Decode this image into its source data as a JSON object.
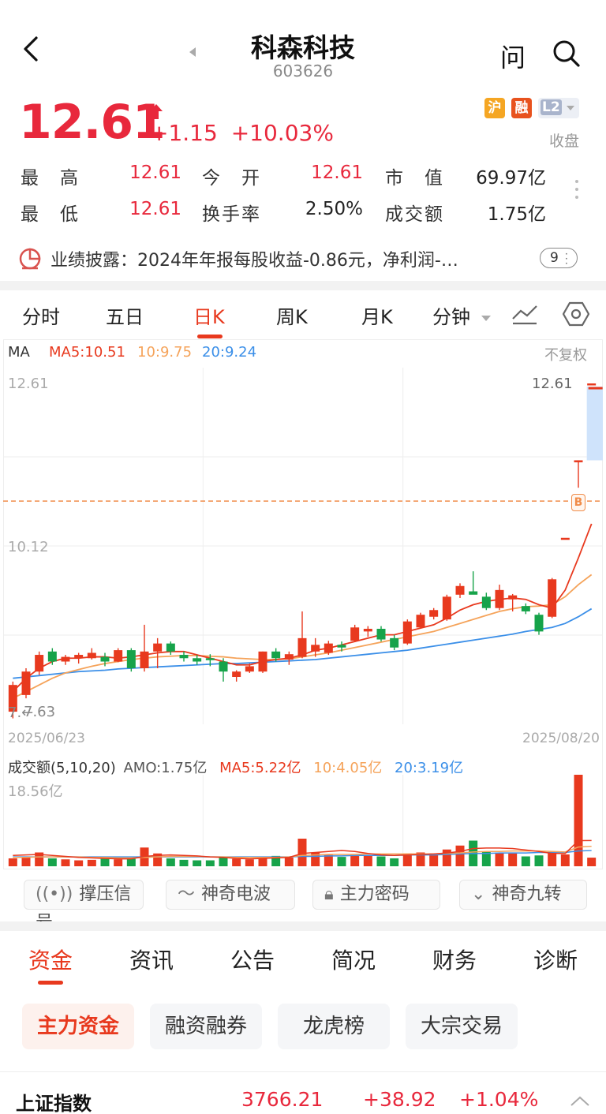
{
  "header": {
    "title": "科森科技",
    "code": "603626",
    "ask_label": "问"
  },
  "quote": {
    "price": "12.61",
    "change": "+1.15",
    "change_pct": "+10.03%",
    "badges": [
      "沪",
      "融",
      "L2"
    ],
    "status": "收盘",
    "stats": [
      {
        "label": "最　高",
        "value": "12.61",
        "color": "red"
      },
      {
        "label": "今　开",
        "value": "12.61",
        "color": "red"
      },
      {
        "label": "市　值",
        "value": "69.97亿",
        "color": "dark"
      },
      {
        "label": "最　低",
        "value": "12.61",
        "color": "red"
      },
      {
        "label": "换手率",
        "value": "2.50%",
        "color": "dark"
      },
      {
        "label": "成交额",
        "value": "1.75亿",
        "color": "dark"
      }
    ]
  },
  "notice": {
    "text": "业绩披露：2024年年报每股收益-0.86元，净利润-…",
    "count": "9"
  },
  "chart_tabs": [
    "分时",
    "五日",
    "日K",
    "周K",
    "月K",
    "分钟"
  ],
  "active_chart_tab": "日K",
  "ma": {
    "label": "MA",
    "ma5": "MA5:10.51",
    "ma10": "10:9.75",
    "ma20": "20:9.24",
    "adjust": "不复权"
  },
  "price_axis": {
    "high": "12.61",
    "mid": "10.12",
    "low": "7.63",
    "last_label": "12.61",
    "buy_marker": "B"
  },
  "date_axis": {
    "start": "2025/06/23",
    "end": "2025/08/20"
  },
  "volume_header": {
    "title": "成交额(5,10,20)",
    "amo": "AMO:1.75亿",
    "ma5": "MA5:5.22亿",
    "ma10": "10:4.05亿",
    "ma20": "20:3.19亿",
    "max": "18.56亿"
  },
  "colors": {
    "up": "#e8391e",
    "down": "#16a34a",
    "ma5": "#e8391e",
    "ma10": "#f5a35a",
    "ma20": "#3b8fe8",
    "accent": "#e8391e"
  },
  "chart_data": {
    "type": "candlestick",
    "x_start": "2025/06/23",
    "x_end": "2025/08/20",
    "ylim": [
      7.63,
      12.61
    ],
    "candles": [
      {
        "o": 7.7,
        "h": 8.15,
        "l": 7.6,
        "c": 8.1
      },
      {
        "o": 7.95,
        "h": 8.35,
        "l": 7.9,
        "c": 8.3
      },
      {
        "o": 8.3,
        "h": 8.6,
        "l": 8.25,
        "c": 8.55
      },
      {
        "o": 8.6,
        "h": 8.65,
        "l": 8.4,
        "c": 8.45
      },
      {
        "o": 8.45,
        "h": 8.55,
        "l": 8.4,
        "c": 8.52
      },
      {
        "o": 8.5,
        "h": 8.58,
        "l": 8.42,
        "c": 8.55
      },
      {
        "o": 8.5,
        "h": 8.65,
        "l": 8.48,
        "c": 8.58
      },
      {
        "o": 8.52,
        "h": 8.58,
        "l": 8.38,
        "c": 8.45
      },
      {
        "o": 8.45,
        "h": 8.65,
        "l": 8.44,
        "c": 8.62
      },
      {
        "o": 8.62,
        "h": 8.65,
        "l": 8.3,
        "c": 8.35
      },
      {
        "o": 8.35,
        "h": 9.0,
        "l": 8.3,
        "c": 8.6
      },
      {
        "o": 8.6,
        "h": 8.8,
        "l": 8.35,
        "c": 8.72
      },
      {
        "o": 8.72,
        "h": 8.75,
        "l": 8.55,
        "c": 8.6
      },
      {
        "o": 8.55,
        "h": 8.6,
        "l": 8.45,
        "c": 8.5
      },
      {
        "o": 8.5,
        "h": 8.55,
        "l": 8.4,
        "c": 8.45
      },
      {
        "o": 8.5,
        "h": 8.56,
        "l": 8.38,
        "c": 8.48
      },
      {
        "o": 8.45,
        "h": 8.5,
        "l": 8.15,
        "c": 8.3
      },
      {
        "o": 8.22,
        "h": 8.32,
        "l": 8.15,
        "c": 8.3
      },
      {
        "o": 8.3,
        "h": 8.42,
        "l": 8.28,
        "c": 8.38
      },
      {
        "o": 8.3,
        "h": 8.6,
        "l": 8.28,
        "c": 8.6
      },
      {
        "o": 8.6,
        "h": 8.65,
        "l": 8.45,
        "c": 8.5
      },
      {
        "o": 8.48,
        "h": 8.6,
        "l": 8.4,
        "c": 8.56
      },
      {
        "o": 8.52,
        "h": 9.2,
        "l": 8.5,
        "c": 8.8
      },
      {
        "o": 8.6,
        "h": 8.8,
        "l": 8.52,
        "c": 8.7
      },
      {
        "o": 8.58,
        "h": 8.76,
        "l": 8.55,
        "c": 8.72
      },
      {
        "o": 8.7,
        "h": 8.75,
        "l": 8.6,
        "c": 8.66
      },
      {
        "o": 8.76,
        "h": 9.0,
        "l": 8.74,
        "c": 8.96
      },
      {
        "o": 8.9,
        "h": 8.98,
        "l": 8.82,
        "c": 8.94
      },
      {
        "o": 8.94,
        "h": 8.98,
        "l": 8.75,
        "c": 8.78
      },
      {
        "o": 8.8,
        "h": 8.85,
        "l": 8.62,
        "c": 8.66
      },
      {
        "o": 8.72,
        "h": 9.08,
        "l": 8.7,
        "c": 9.05
      },
      {
        "o": 8.96,
        "h": 9.18,
        "l": 8.94,
        "c": 9.15
      },
      {
        "o": 9.12,
        "h": 9.25,
        "l": 9.08,
        "c": 9.22
      },
      {
        "o": 9.08,
        "h": 9.45,
        "l": 9.06,
        "c": 9.42
      },
      {
        "o": 9.45,
        "h": 9.62,
        "l": 9.4,
        "c": 9.58
      },
      {
        "o": 9.5,
        "h": 9.8,
        "l": 9.48,
        "c": 9.45
      },
      {
        "o": 9.42,
        "h": 9.48,
        "l": 9.22,
        "c": 9.25
      },
      {
        "o": 9.25,
        "h": 9.6,
        "l": 9.22,
        "c": 9.52
      },
      {
        "o": 9.38,
        "h": 9.46,
        "l": 9.2,
        "c": 9.44
      },
      {
        "o": 9.28,
        "h": 9.32,
        "l": 9.16,
        "c": 9.2
      },
      {
        "o": 9.15,
        "h": 9.18,
        "l": 8.85,
        "c": 8.9
      },
      {
        "o": 9.12,
        "h": 9.7,
        "l": 9.1,
        "c": 9.68
      },
      {
        "o": 10.3,
        "h": 10.3,
        "l": 10.3,
        "c": 10.3
      },
      {
        "o": 11.46,
        "h": 11.46,
        "l": 11.05,
        "c": 11.46
      },
      {
        "o": 12.61,
        "h": 12.61,
        "l": 12.61,
        "c": 12.61
      }
    ],
    "ma5": [
      8.0,
      8.2,
      8.35,
      8.45,
      8.5,
      8.5,
      8.52,
      8.52,
      8.5,
      8.52,
      8.55,
      8.58,
      8.6,
      8.6,
      8.55,
      8.5,
      8.45,
      8.4,
      8.4,
      8.45,
      8.48,
      8.5,
      8.55,
      8.62,
      8.65,
      8.7,
      8.75,
      8.8,
      8.85,
      8.85,
      8.9,
      8.95,
      9.0,
      9.1,
      9.22,
      9.3,
      9.35,
      9.38,
      9.4,
      9.38,
      9.3,
      9.25,
      9.52,
      10.0,
      10.51
    ],
    "ma10": [
      7.9,
      8.0,
      8.1,
      8.2,
      8.28,
      8.33,
      8.38,
      8.42,
      8.45,
      8.48,
      8.5,
      8.52,
      8.53,
      8.54,
      8.54,
      8.53,
      8.52,
      8.5,
      8.49,
      8.48,
      8.48,
      8.49,
      8.52,
      8.55,
      8.58,
      8.62,
      8.66,
      8.7,
      8.74,
      8.78,
      8.82,
      8.86,
      8.9,
      8.96,
      9.02,
      9.08,
      9.14,
      9.2,
      9.24,
      9.27,
      9.28,
      9.3,
      9.42,
      9.6,
      9.75
    ],
    "ma20": [
      8.2,
      8.22,
      8.24,
      8.26,
      8.28,
      8.3,
      8.31,
      8.32,
      8.34,
      8.35,
      8.36,
      8.37,
      8.38,
      8.39,
      8.4,
      8.41,
      8.42,
      8.42,
      8.43,
      8.44,
      8.45,
      8.46,
      8.47,
      8.48,
      8.5,
      8.52,
      8.54,
      8.56,
      8.58,
      8.6,
      8.62,
      8.65,
      8.68,
      8.71,
      8.74,
      8.77,
      8.8,
      8.83,
      8.86,
      8.9,
      8.93,
      8.96,
      9.02,
      9.12,
      9.24
    ],
    "volume": {
      "ymax": 18.56,
      "amo": [
        1.6,
        2.0,
        2.8,
        1.6,
        1.4,
        1.2,
        1.3,
        1.5,
        1.4,
        1.5,
        3.8,
        2.6,
        1.6,
        1.3,
        1.2,
        1.2,
        2.0,
        1.5,
        1.4,
        2.0,
        2.1,
        1.8,
        5.6,
        2.8,
        2.4,
        1.9,
        2.4,
        2.1,
        2.0,
        1.6,
        2.6,
        2.8,
        2.6,
        3.4,
        4.2,
        5.2,
        2.9,
        2.8,
        2.6,
        2.0,
        2.2,
        2.8,
        2.4,
        18.56,
        1.75
      ],
      "ma5": [
        2.2,
        2.3,
        2.4,
        2.2,
        2.0,
        1.8,
        1.7,
        1.6,
        1.5,
        1.5,
        2.0,
        2.2,
        2.3,
        2.2,
        2.1,
        1.9,
        1.8,
        1.6,
        1.5,
        1.6,
        1.7,
        1.8,
        2.6,
        2.8,
        3.0,
        3.2,
        3.0,
        2.6,
        2.3,
        2.2,
        2.3,
        2.4,
        2.5,
        2.7,
        3.0,
        3.6,
        3.7,
        3.7,
        3.6,
        3.3,
        3.0,
        2.6,
        2.6,
        5.2,
        5.22
      ],
      "ma10": [
        1.8,
        1.8,
        1.9,
        1.9,
        1.9,
        1.9,
        1.8,
        1.8,
        1.7,
        1.7,
        1.8,
        1.9,
        2.0,
        2.0,
        2.0,
        1.9,
        1.9,
        1.8,
        1.8,
        1.8,
        1.8,
        1.9,
        2.2,
        2.3,
        2.4,
        2.4,
        2.4,
        2.5,
        2.5,
        2.5,
        2.5,
        2.5,
        2.5,
        2.6,
        2.7,
        2.9,
        3.0,
        3.0,
        3.1,
        3.1,
        3.1,
        3.0,
        2.9,
        3.9,
        4.05
      ],
      "ma20": [
        1.9,
        1.9,
        1.9,
        1.9,
        1.9,
        1.9,
        1.9,
        1.9,
        1.9,
        1.9,
        1.9,
        1.9,
        1.9,
        1.9,
        1.9,
        1.9,
        1.9,
        1.9,
        1.9,
        1.9,
        1.9,
        1.9,
        2.0,
        2.0,
        2.1,
        2.1,
        2.2,
        2.2,
        2.2,
        2.2,
        2.3,
        2.3,
        2.3,
        2.4,
        2.5,
        2.6,
        2.6,
        2.7,
        2.7,
        2.7,
        2.8,
        2.8,
        2.8,
        3.1,
        3.19
      ]
    }
  },
  "indicator_chips": [
    "撑压信号",
    "神奇电波",
    "主力密码",
    "神奇九转"
  ],
  "bottom_tabs": [
    "资金",
    "资讯",
    "公告",
    "简况",
    "财务",
    "诊断"
  ],
  "active_bottom_tab": "资金",
  "sub_tabs": [
    "主力资金",
    "融资融券",
    "龙虎榜",
    "大宗交易"
  ],
  "active_sub_tab": "主力资金",
  "index_bar": {
    "name": "上证指数",
    "value": "3766.21",
    "change": "+38.92",
    "change_pct": "+1.04%"
  }
}
